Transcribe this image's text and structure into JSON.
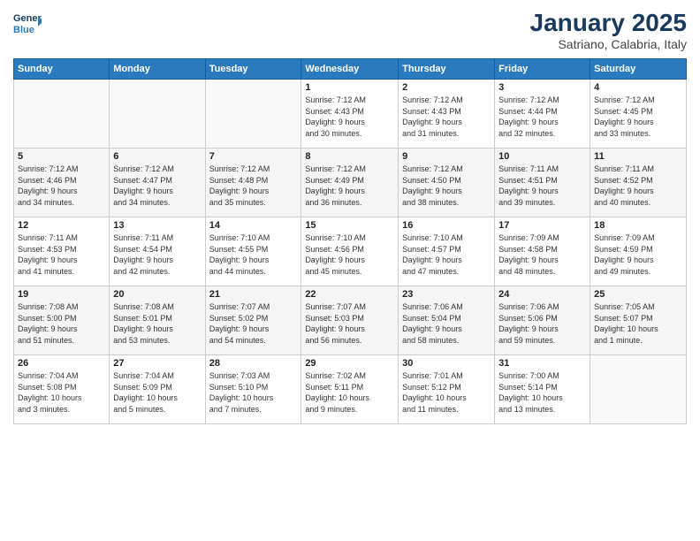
{
  "header": {
    "logo_line1": "General",
    "logo_line2": "Blue",
    "month": "January 2025",
    "location": "Satriano, Calabria, Italy"
  },
  "weekdays": [
    "Sunday",
    "Monday",
    "Tuesday",
    "Wednesday",
    "Thursday",
    "Friday",
    "Saturday"
  ],
  "weeks": [
    [
      {
        "day": "",
        "detail": ""
      },
      {
        "day": "",
        "detail": ""
      },
      {
        "day": "",
        "detail": ""
      },
      {
        "day": "1",
        "detail": "Sunrise: 7:12 AM\nSunset: 4:43 PM\nDaylight: 9 hours\nand 30 minutes."
      },
      {
        "day": "2",
        "detail": "Sunrise: 7:12 AM\nSunset: 4:43 PM\nDaylight: 9 hours\nand 31 minutes."
      },
      {
        "day": "3",
        "detail": "Sunrise: 7:12 AM\nSunset: 4:44 PM\nDaylight: 9 hours\nand 32 minutes."
      },
      {
        "day": "4",
        "detail": "Sunrise: 7:12 AM\nSunset: 4:45 PM\nDaylight: 9 hours\nand 33 minutes."
      }
    ],
    [
      {
        "day": "5",
        "detail": "Sunrise: 7:12 AM\nSunset: 4:46 PM\nDaylight: 9 hours\nand 34 minutes."
      },
      {
        "day": "6",
        "detail": "Sunrise: 7:12 AM\nSunset: 4:47 PM\nDaylight: 9 hours\nand 34 minutes."
      },
      {
        "day": "7",
        "detail": "Sunrise: 7:12 AM\nSunset: 4:48 PM\nDaylight: 9 hours\nand 35 minutes."
      },
      {
        "day": "8",
        "detail": "Sunrise: 7:12 AM\nSunset: 4:49 PM\nDaylight: 9 hours\nand 36 minutes."
      },
      {
        "day": "9",
        "detail": "Sunrise: 7:12 AM\nSunset: 4:50 PM\nDaylight: 9 hours\nand 38 minutes."
      },
      {
        "day": "10",
        "detail": "Sunrise: 7:11 AM\nSunset: 4:51 PM\nDaylight: 9 hours\nand 39 minutes."
      },
      {
        "day": "11",
        "detail": "Sunrise: 7:11 AM\nSunset: 4:52 PM\nDaylight: 9 hours\nand 40 minutes."
      }
    ],
    [
      {
        "day": "12",
        "detail": "Sunrise: 7:11 AM\nSunset: 4:53 PM\nDaylight: 9 hours\nand 41 minutes."
      },
      {
        "day": "13",
        "detail": "Sunrise: 7:11 AM\nSunset: 4:54 PM\nDaylight: 9 hours\nand 42 minutes."
      },
      {
        "day": "14",
        "detail": "Sunrise: 7:10 AM\nSunset: 4:55 PM\nDaylight: 9 hours\nand 44 minutes."
      },
      {
        "day": "15",
        "detail": "Sunrise: 7:10 AM\nSunset: 4:56 PM\nDaylight: 9 hours\nand 45 minutes."
      },
      {
        "day": "16",
        "detail": "Sunrise: 7:10 AM\nSunset: 4:57 PM\nDaylight: 9 hours\nand 47 minutes."
      },
      {
        "day": "17",
        "detail": "Sunrise: 7:09 AM\nSunset: 4:58 PM\nDaylight: 9 hours\nand 48 minutes."
      },
      {
        "day": "18",
        "detail": "Sunrise: 7:09 AM\nSunset: 4:59 PM\nDaylight: 9 hours\nand 49 minutes."
      }
    ],
    [
      {
        "day": "19",
        "detail": "Sunrise: 7:08 AM\nSunset: 5:00 PM\nDaylight: 9 hours\nand 51 minutes."
      },
      {
        "day": "20",
        "detail": "Sunrise: 7:08 AM\nSunset: 5:01 PM\nDaylight: 9 hours\nand 53 minutes."
      },
      {
        "day": "21",
        "detail": "Sunrise: 7:07 AM\nSunset: 5:02 PM\nDaylight: 9 hours\nand 54 minutes."
      },
      {
        "day": "22",
        "detail": "Sunrise: 7:07 AM\nSunset: 5:03 PM\nDaylight: 9 hours\nand 56 minutes."
      },
      {
        "day": "23",
        "detail": "Sunrise: 7:06 AM\nSunset: 5:04 PM\nDaylight: 9 hours\nand 58 minutes."
      },
      {
        "day": "24",
        "detail": "Sunrise: 7:06 AM\nSunset: 5:06 PM\nDaylight: 9 hours\nand 59 minutes."
      },
      {
        "day": "25",
        "detail": "Sunrise: 7:05 AM\nSunset: 5:07 PM\nDaylight: 10 hours\nand 1 minute."
      }
    ],
    [
      {
        "day": "26",
        "detail": "Sunrise: 7:04 AM\nSunset: 5:08 PM\nDaylight: 10 hours\nand 3 minutes."
      },
      {
        "day": "27",
        "detail": "Sunrise: 7:04 AM\nSunset: 5:09 PM\nDaylight: 10 hours\nand 5 minutes."
      },
      {
        "day": "28",
        "detail": "Sunrise: 7:03 AM\nSunset: 5:10 PM\nDaylight: 10 hours\nand 7 minutes."
      },
      {
        "day": "29",
        "detail": "Sunrise: 7:02 AM\nSunset: 5:11 PM\nDaylight: 10 hours\nand 9 minutes."
      },
      {
        "day": "30",
        "detail": "Sunrise: 7:01 AM\nSunset: 5:12 PM\nDaylight: 10 hours\nand 11 minutes."
      },
      {
        "day": "31",
        "detail": "Sunrise: 7:00 AM\nSunset: 5:14 PM\nDaylight: 10 hours\nand 13 minutes."
      },
      {
        "day": "",
        "detail": ""
      }
    ]
  ]
}
